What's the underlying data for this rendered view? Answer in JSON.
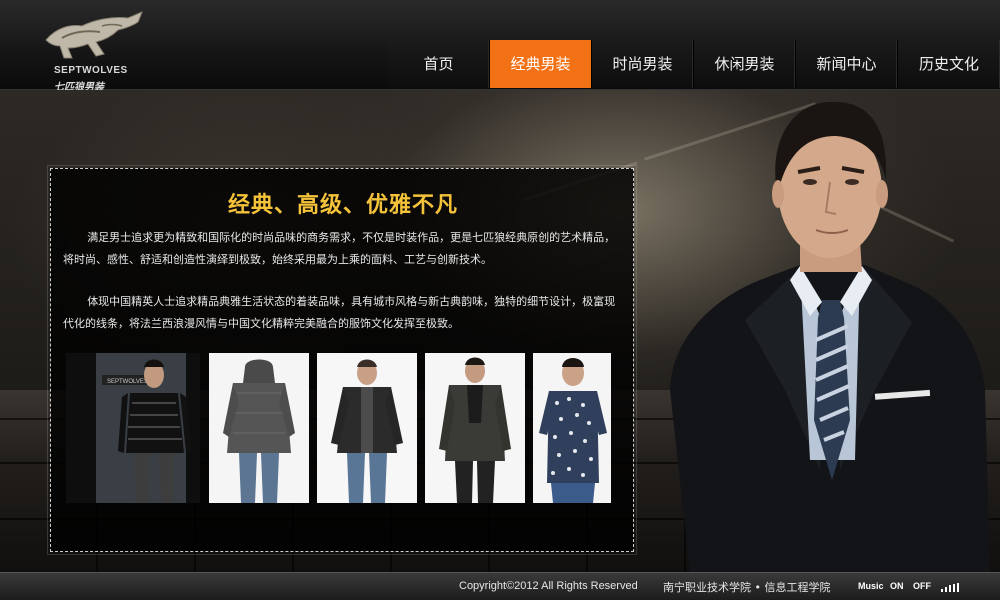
{
  "brand": {
    "name_en": "SEPTWOLVES",
    "name_cn": "七匹狼男装"
  },
  "nav": {
    "items": [
      {
        "label": "首页",
        "active": false
      },
      {
        "label": "经典男装",
        "active": true
      },
      {
        "label": "时尚男装",
        "active": false
      },
      {
        "label": "休闲男装",
        "active": false
      },
      {
        "label": "新闻中心",
        "active": false
      },
      {
        "label": "历史文化",
        "active": false
      }
    ]
  },
  "content": {
    "title": "经典、高级、优雅不凡",
    "paragraphs": [
      "满足男士追求更为精致和国际化的时尚品味的商务需求，不仅是时装作品，更是七匹狼经典原创的艺术精品，将时尚、感性、舒适和创造性演绎到极致，始终采用最为上乘的面料、工艺与创新技术。",
      "体现中国精英人士追求精品典雅生活状态的着装品味，具有城市风格与新古典韵味，独特的细节设计，极富现代化的线条，将法兰西浪漫风情与中国文化精粹完美融合的服饰文化发挥至极致。"
    ],
    "photos": [
      {
        "alt": "black leather jacket model",
        "tag": "SEPTWOLVES"
      },
      {
        "alt": "grey hooded jacket back view"
      },
      {
        "alt": "dark jacket with jeans"
      },
      {
        "alt": "dark blazer with sweater"
      },
      {
        "alt": "patterned short sleeve shirt"
      }
    ]
  },
  "footer": {
    "copyright": "Copyright©2012 All Rights Reserved",
    "school": "南宁职业技术学院 • 信息工程学院",
    "music_label": "Music",
    "music_on": "ON",
    "music_off": "OFF"
  },
  "colors": {
    "accent": "#f37115",
    "title": "#f5c33a"
  }
}
